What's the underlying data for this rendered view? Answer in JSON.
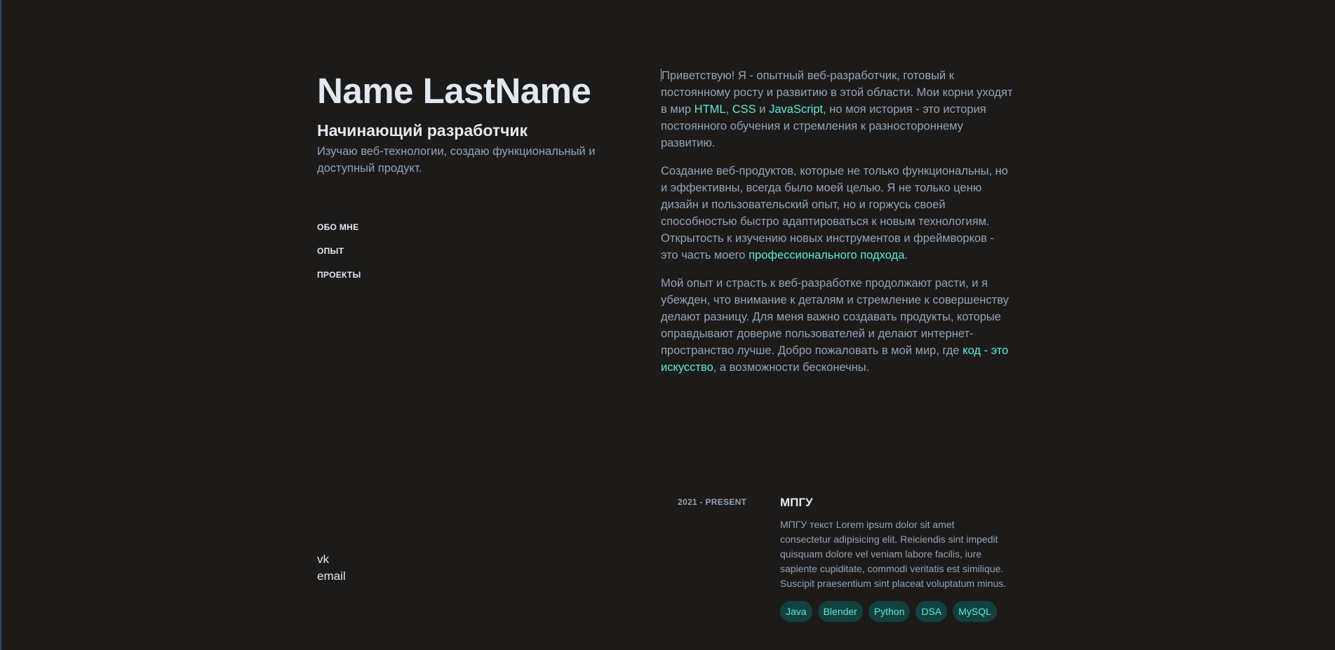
{
  "header": {
    "name": "Name LastName",
    "role": "Начинающий разработчик",
    "tagline": "Изучаю веб-технологии, создаю функциональный и доступный продукт."
  },
  "nav": {
    "items": [
      {
        "label": "ОБО МНЕ"
      },
      {
        "label": "ОПЫТ"
      },
      {
        "label": "ПРОЕКТЫ"
      }
    ]
  },
  "socials": {
    "vk": "vk",
    "email": "email"
  },
  "about": {
    "p1": {
      "t1": "Приветствую! Я - опытный веб-разработчик, готовый к постоянному росту и развитию в этой области. Мои корни уходят в мир ",
      "html": "HTML",
      "t2": ", ",
      "css": "CSS",
      "t3": " и ",
      "js": "JavaScript",
      "t4": ", но моя история - это история постоянного обучения и стремления к разностороннему развитию."
    },
    "p2": {
      "t1": "Создание веб-продуктов, которые не только функциональны, но и эффективны, всегда было моей целью. Я не только ценю дизайн и пользовательский опыт, но и горжусь своей способностью быстро адаптироваться к новым технологиям. Открытость к изучению новых инструментов и фреймворков - это часть моего ",
      "link": "профессионального подхода",
      "t2": "."
    },
    "p3": {
      "t1": "Мой опыт и страсть к веб-разработке продолжают расти, и я убежден, что внимание к деталям и стремление к совершенству делают разницу. Для меня важно создавать продукты, которые оправдывают доверие пользователей и делают интернет-пространство лучше. Добро пожаловать в мой мир, где ",
      "link": "код - это искусство",
      "t2": ", а возможности бесконечны."
    }
  },
  "experience": {
    "date": "2021 - PRESENT",
    "title": "МПГУ",
    "description": "МПГУ текст Lorem ipsum dolor sit amet consectetur adipisicing elit. Reiciendis sint impedit quisquam dolore vel veniam labore facilis, iure sapiente cupiditate, commodi veritatis est similique. Suscipit praesentium sint placeat voluptatum minus.",
    "tags": [
      "Java",
      "Blender",
      "Python",
      "DSA",
      "MySQL"
    ]
  },
  "colors": {
    "background": "#1c1b1a",
    "accent": "#5eead4",
    "heading": "#e2e8f0",
    "text": "#94a3b8",
    "tag_bg": "#12413f"
  }
}
